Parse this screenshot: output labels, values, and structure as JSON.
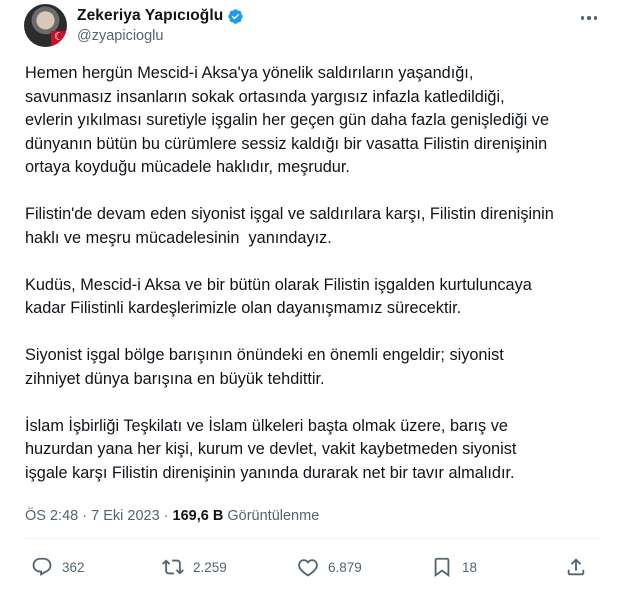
{
  "author": {
    "name": "Zekeriya Yapıcıoğlu",
    "handle": "@zyapicioglu",
    "verified": true
  },
  "tweet": {
    "paragraphs": [
      "Hemen hergün Mescid-i Aksa'ya yönelik saldırıların yaşandığı,\nsavunmasız insanların sokak ortasında yargısız infazla katledildiği,\nevlerin yıkılması suretiyle işgalin her geçen gün daha fazla genişlediği ve\ndünyanın bütün bu cürümlere sessiz kaldığı bir vasatta Filistin direnişinin\nortaya koyduğu mücadele haklıdır, meşrudur.",
      "Filistin'de devam eden siyonist işgal ve saldırılara karşı, Filistin direnişinin\nhaklı ve meşru mücadelesinin  yanındayız.",
      "Kudüs, Mescid-i Aksa ve bir bütün olarak Filistin işgalden kurtuluncaya\nkadar Filistinli kardeşlerimizle olan dayanışmamız sürecektir.",
      "Siyonist işgal bölge barışının önündeki en önemli engeldir; siyonist\nzihniyet dünya barışına en büyük tehdittir.",
      "İslam İşbirliği Teşkilatı ve İslam ülkeleri başta olmak üzere, barış ve\nhuzurdan yana her kişi, kurum ve devlet, vakit kaybetmeden siyonist\nişgale karşı Filistin direnişinin yanında durarak net bir tavır almalıdır."
    ],
    "time": "ÖS 2:48",
    "separator": "·",
    "date": "7 Eki 2023",
    "views_count": "169,6 B",
    "views_label": "Görüntülenme"
  },
  "actions": {
    "replies": "362",
    "reposts": "2.259",
    "likes": "6.879",
    "bookmarks": "18"
  },
  "colors": {
    "text": "#0f1419",
    "secondary": "#536471",
    "verified": "#1d9bf0",
    "divider": "#eff3f4"
  },
  "icons": [
    "verified-badge-icon",
    "more-icon",
    "reply-icon",
    "repost-icon",
    "like-icon",
    "bookmark-icon",
    "share-icon"
  ]
}
